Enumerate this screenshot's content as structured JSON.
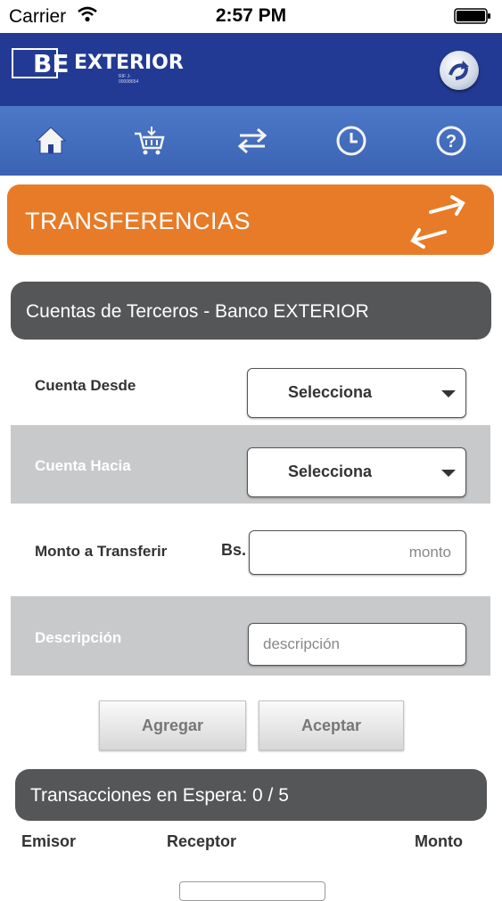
{
  "status_bar": {
    "carrier": "Carrier",
    "time": "2:57 PM"
  },
  "header": {
    "logo_text": "EXTERIOR",
    "logo_subtext": "RIF J-00008654",
    "logo_mark": "BE"
  },
  "nav": {
    "items": [
      "home-icon",
      "shopping-cart-icon",
      "transfer-arrows-icon",
      "clock-icon",
      "help-icon"
    ]
  },
  "section": {
    "title": "TRANSFERENCIAS"
  },
  "subheader": {
    "title": "Cuentas de Terceros - Banco EXTERIOR"
  },
  "form": {
    "cuenta_desde": {
      "label": "Cuenta Desde",
      "value": "Selecciona"
    },
    "cuenta_hacia": {
      "label": "Cuenta Hacia",
      "value": "Selecciona"
    },
    "monto": {
      "label": "Monto a Transferir",
      "currency": "Bs.",
      "placeholder": "monto"
    },
    "descripcion": {
      "label": "Descripción",
      "placeholder": "descripción"
    }
  },
  "buttons": {
    "agregar": "Agregar",
    "aceptar": "Aceptar"
  },
  "pending": {
    "title": "Transacciones en Espera: 0 / 5",
    "columns": [
      "Emisor",
      "Receptor",
      "Monto"
    ]
  },
  "colors": {
    "header_bg": "#233a94",
    "nav_bg": "#3a63b3",
    "accent_orange": "#e87b27",
    "dark_bar": "#555657",
    "gray_row": "#c8c9ca"
  }
}
